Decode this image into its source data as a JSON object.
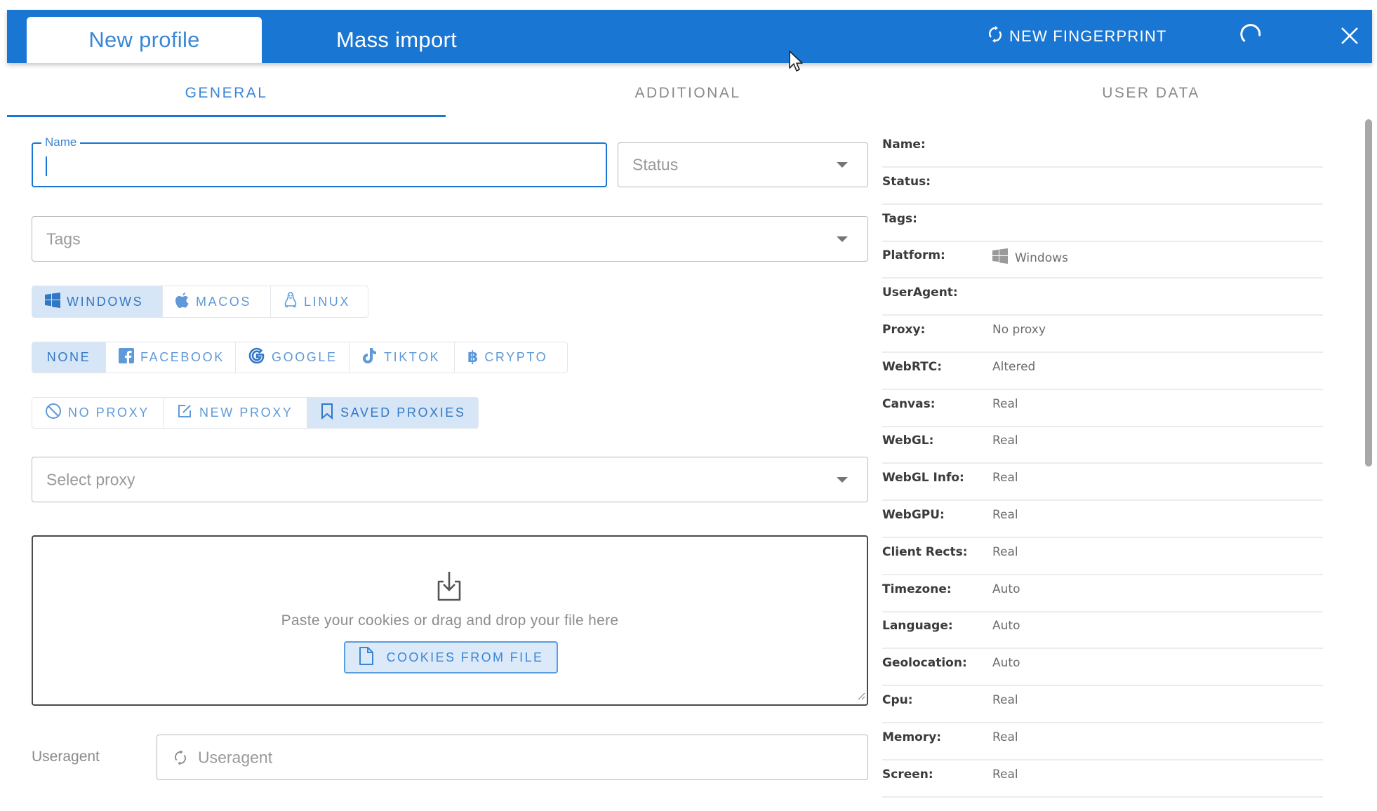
{
  "header": {
    "tabs": [
      {
        "label": "New profile",
        "active": true
      },
      {
        "label": "Mass import",
        "active": false
      }
    ],
    "new_fingerprint_label": "NEW FINGERPRINT",
    "colors": {
      "primary": "#1976d2",
      "accent_text": "#3a86d6",
      "selected_bg": "#d6e6f7"
    }
  },
  "subtabs": [
    {
      "label": "GENERAL",
      "active": true
    },
    {
      "label": "ADDITIONAL",
      "active": false
    },
    {
      "label": "USER DATA",
      "active": false
    }
  ],
  "form": {
    "name": {
      "label": "Name",
      "value": ""
    },
    "status": {
      "placeholder": "Status"
    },
    "tags": {
      "placeholder": "Tags"
    },
    "os_options": [
      {
        "label": "WINDOWS",
        "icon": "windows-icon",
        "selected": true
      },
      {
        "label": "MACOS",
        "icon": "apple-icon",
        "selected": false
      },
      {
        "label": "LINUX",
        "icon": "linux-icon",
        "selected": false
      }
    ],
    "site_options": [
      {
        "label": "NONE",
        "icon": "",
        "selected": true
      },
      {
        "label": "FACEBOOK",
        "icon": "facebook-icon",
        "selected": false
      },
      {
        "label": "GOOGLE",
        "icon": "google-icon",
        "selected": false
      },
      {
        "label": "TIKTOK",
        "icon": "tiktok-icon",
        "selected": false
      },
      {
        "label": "CRYPTO",
        "icon": "bitcoin-icon",
        "selected": false
      }
    ],
    "proxy_options": [
      {
        "label": "NO PROXY",
        "icon": "block-icon",
        "selected": false
      },
      {
        "label": "NEW PROXY",
        "icon": "edit-icon",
        "selected": false
      },
      {
        "label": "SAVED PROXIES",
        "icon": "bookmark-icon",
        "selected": true
      }
    ],
    "select_proxy": {
      "placeholder": "Select proxy"
    },
    "cookies": {
      "hint": "Paste your cookies or drag and drop your file here",
      "button_label": "COOKIES FROM FILE"
    },
    "useragent": {
      "label": "Useragent",
      "placeholder": "Useragent"
    }
  },
  "summary": [
    {
      "label": "Name:",
      "value": ""
    },
    {
      "label": "Status:",
      "value": ""
    },
    {
      "label": "Tags:",
      "value": ""
    },
    {
      "label": "Platform:",
      "value": "Windows",
      "icon": "windows-icon"
    },
    {
      "label": "UserAgent:",
      "value": ""
    },
    {
      "label": "Proxy:",
      "value": "No proxy"
    },
    {
      "label": "WebRTC:",
      "value": "Altered"
    },
    {
      "label": "Canvas:",
      "value": "Real"
    },
    {
      "label": "WebGL:",
      "value": "Real"
    },
    {
      "label": "WebGL Info:",
      "value": "Real"
    },
    {
      "label": "WebGPU:",
      "value": "Real"
    },
    {
      "label": "Client Rects:",
      "value": "Real"
    },
    {
      "label": "Timezone:",
      "value": "Auto"
    },
    {
      "label": "Language:",
      "value": "Auto"
    },
    {
      "label": "Geolocation:",
      "value": "Auto"
    },
    {
      "label": "Cpu:",
      "value": "Real"
    },
    {
      "label": "Memory:",
      "value": "Real"
    },
    {
      "label": "Screen:",
      "value": "Real"
    }
  ]
}
